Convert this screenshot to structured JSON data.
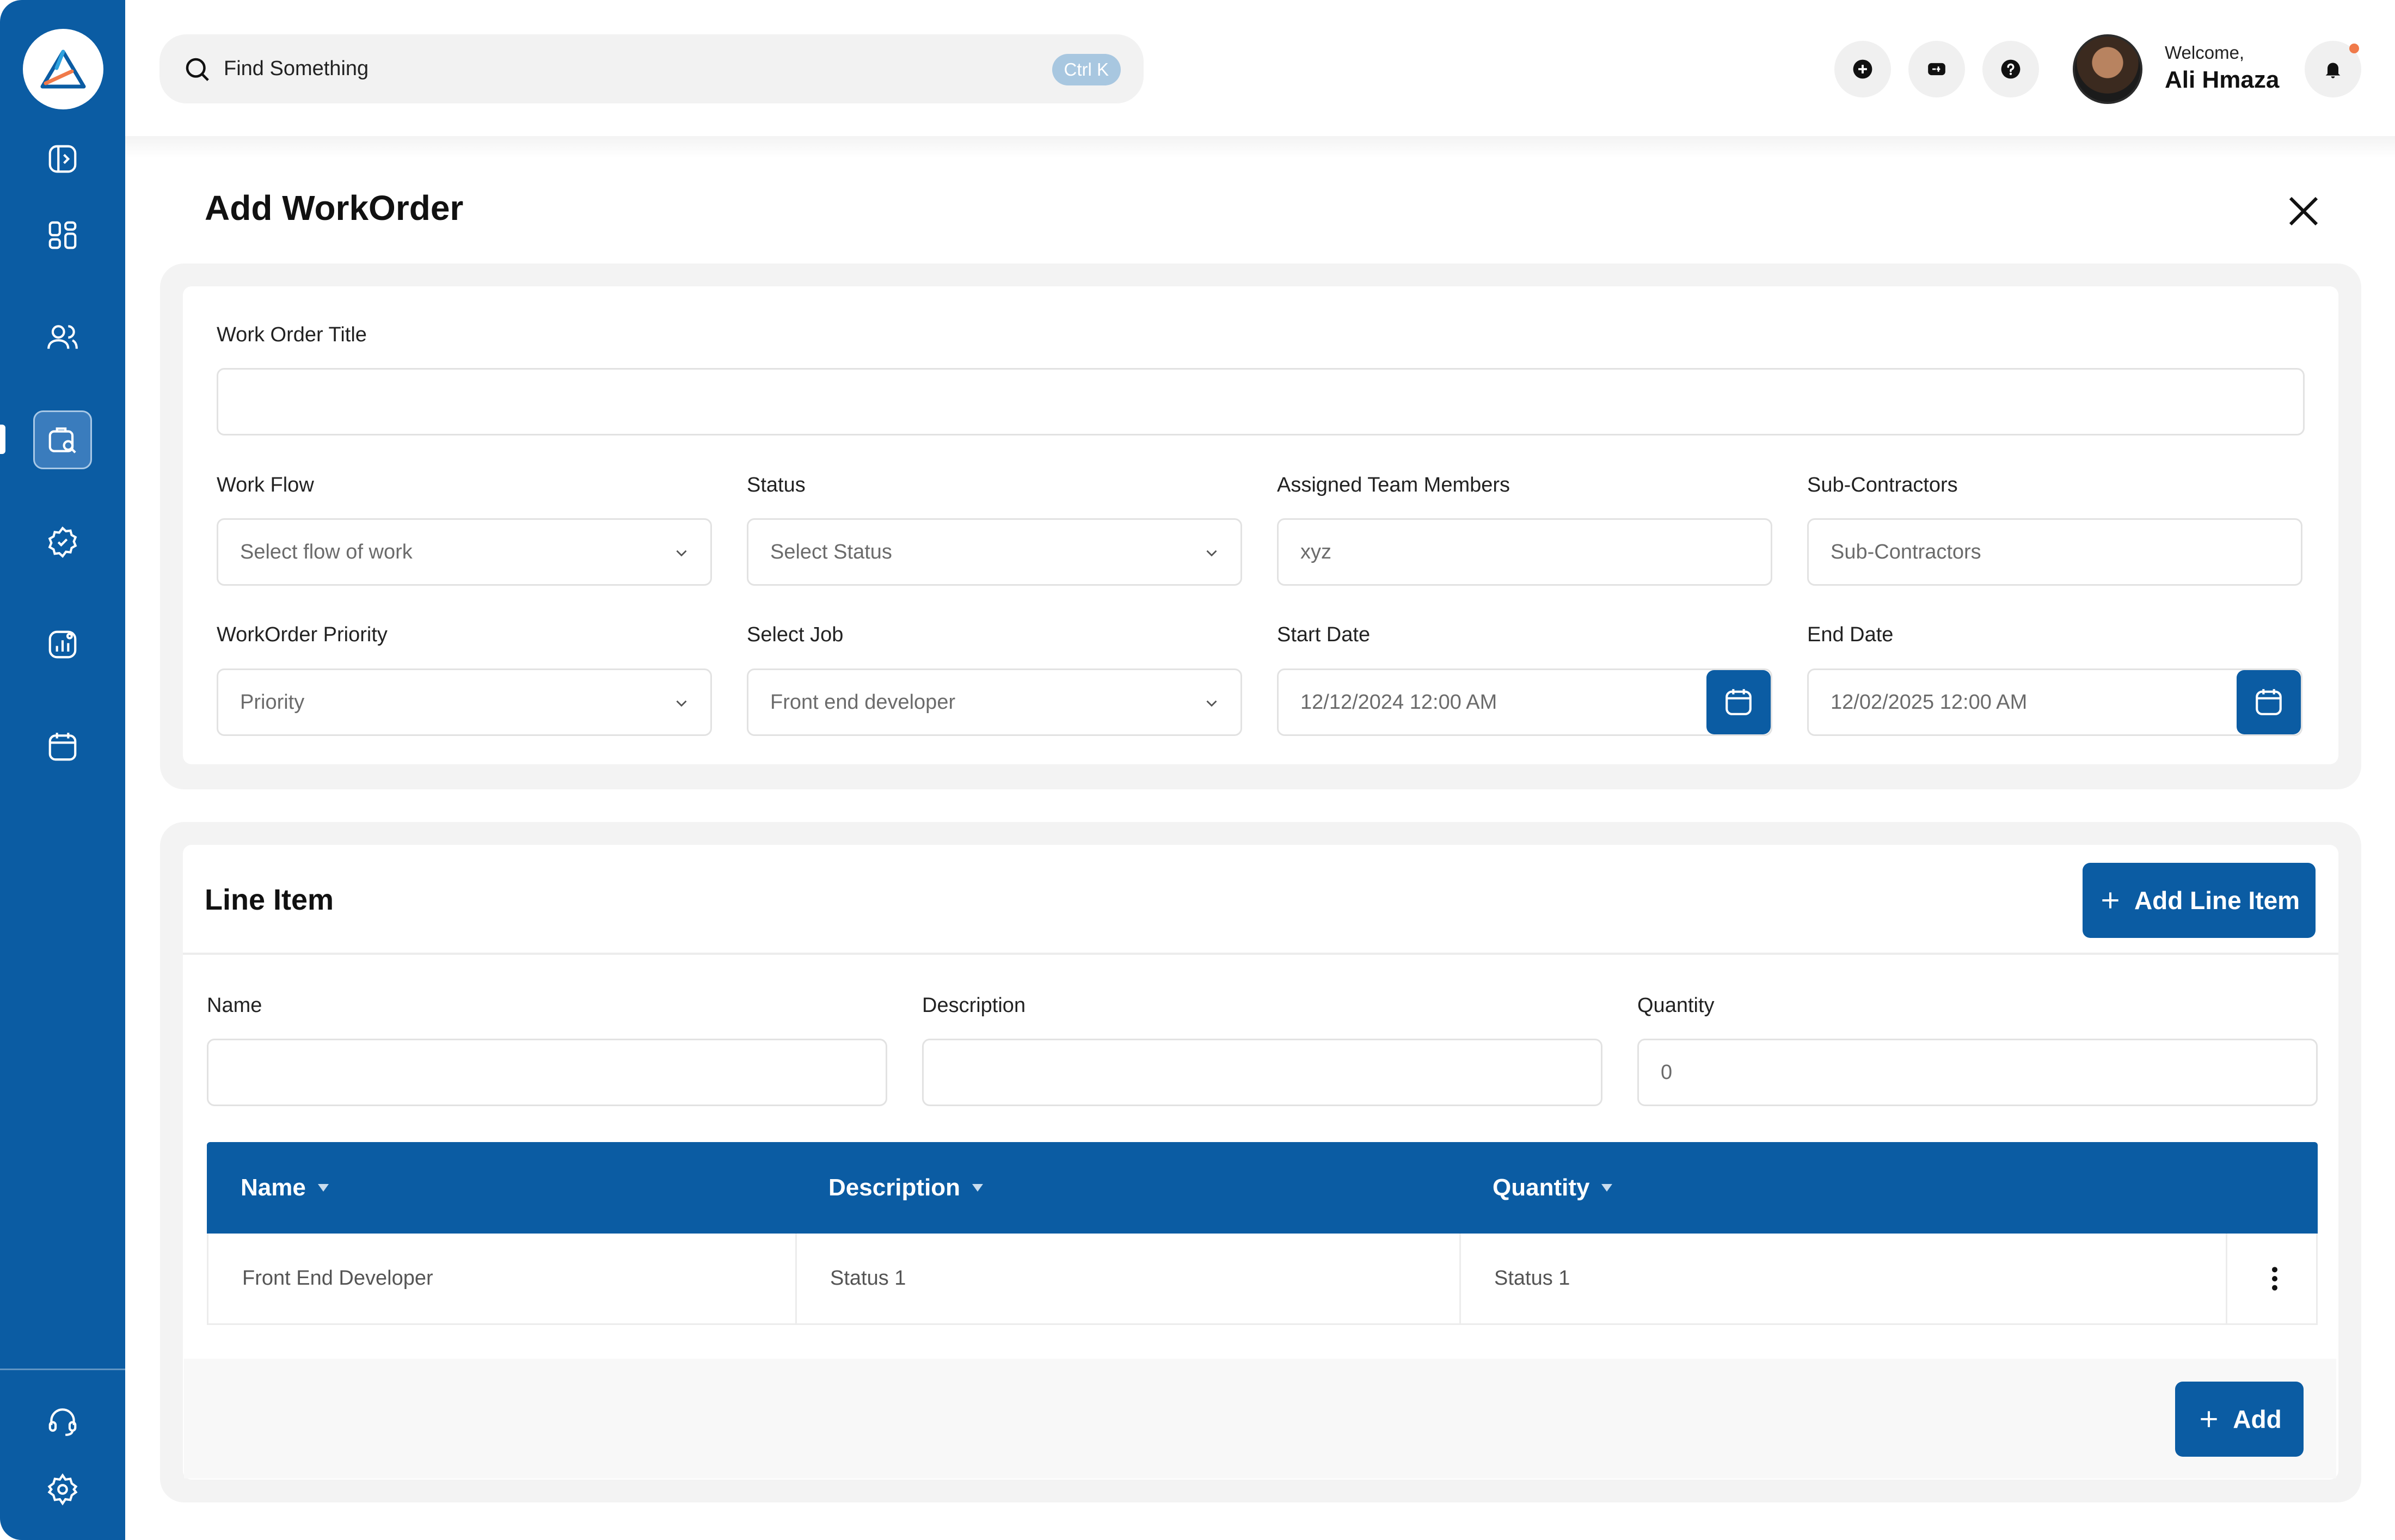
{
  "sidebar": {
    "nav_items": [
      "sidebar-toggle",
      "dashboard",
      "users",
      "work-orders",
      "badge",
      "reports",
      "calendar"
    ],
    "bottom_items": [
      "support",
      "settings"
    ],
    "active": "work-orders"
  },
  "topbar": {
    "search_placeholder": "Find Something",
    "search_shortcut": "Ctrl K",
    "welcome": "Welcome,",
    "username": "Ali Hmaza"
  },
  "page": {
    "title": "Add WorkOrder"
  },
  "form": {
    "title_label": "Work Order Title",
    "title_value": "",
    "workflow_label": "Work Flow",
    "workflow_placeholder": "Select flow of work",
    "status_label": "Status",
    "status_placeholder": "Select Status",
    "team_label": "Assigned Team Members",
    "team_placeholder": "xyz",
    "subcontractors_label": "Sub-Contractors",
    "subcontractors_placeholder": "Sub-Contractors",
    "priority_label": "WorkOrder Priority",
    "priority_placeholder": "Priority",
    "job_label": "Select Job",
    "job_value": "Front end developer",
    "start_label": "Start Date",
    "start_value": "12/12/2024 12:00 AM",
    "end_label": "End Date",
    "end_value": "12/02/2025 12:00 AM"
  },
  "line_item": {
    "title": "Line Item",
    "add_button": "Add Line Item",
    "name_label": "Name",
    "description_label": "Description",
    "quantity_label": "Quantity",
    "quantity_placeholder": "0",
    "columns": [
      "Name",
      "Description",
      "Quantity"
    ],
    "rows": [
      {
        "name": "Front End Developer",
        "description": "Status 1",
        "quantity": "Status 1"
      }
    ],
    "footer_button": "Add"
  },
  "colors": {
    "primary": "#0b5ca3",
    "notification_dot": "#f07a4a"
  }
}
